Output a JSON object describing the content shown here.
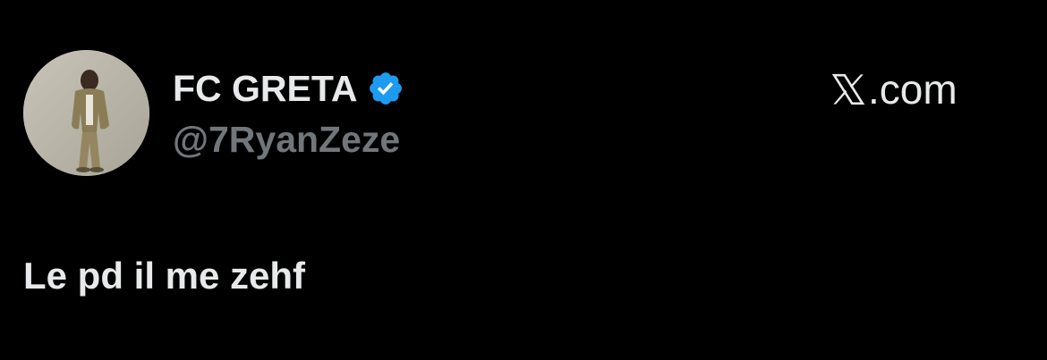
{
  "tweet": {
    "author": {
      "display_name": "FC GRETA",
      "handle": "@7RyanZeze",
      "verified": true,
      "verified_badge_color": "#1d9bf0",
      "avatar_icon": "profile-photo"
    },
    "brand": {
      "logo_icon": "x-logo-icon",
      "text": ".com"
    },
    "text": "Le pd il me zehf"
  },
  "colors": {
    "background": "#000000",
    "primary_text": "#e7e9ea",
    "secondary_text": "#71767b",
    "accent": "#1d9bf0"
  }
}
